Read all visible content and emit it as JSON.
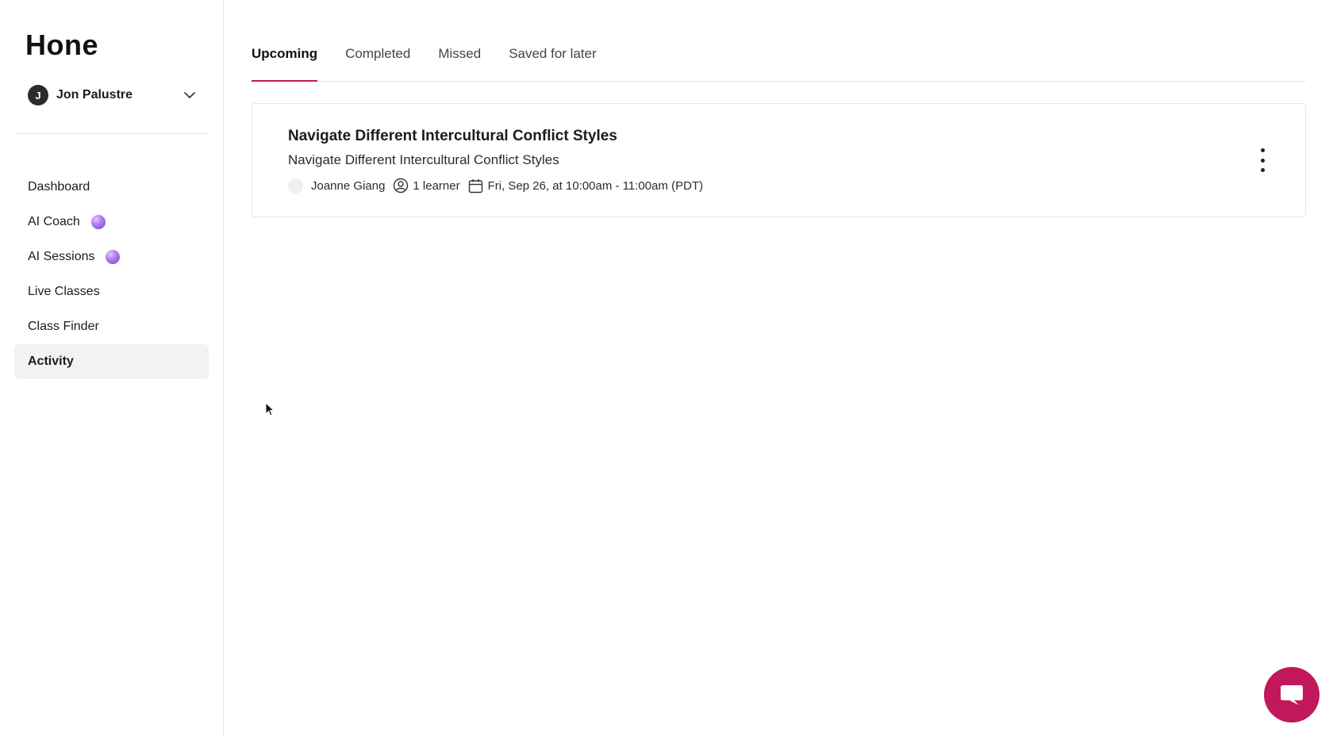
{
  "app": {
    "logo": "Hone"
  },
  "user": {
    "initial": "J",
    "name": "Jon Palustre"
  },
  "nav": {
    "items": [
      {
        "label": "Dashboard",
        "badge": false,
        "active": false
      },
      {
        "label": "AI Coach",
        "badge": true,
        "active": false
      },
      {
        "label": "AI Sessions",
        "badge": true,
        "active": false
      },
      {
        "label": "Live Classes",
        "badge": false,
        "active": false
      },
      {
        "label": "Class Finder",
        "badge": false,
        "active": false
      },
      {
        "label": "Activity",
        "badge": false,
        "active": true
      }
    ]
  },
  "tabs": [
    {
      "label": "Upcoming",
      "active": true
    },
    {
      "label": "Completed",
      "active": false
    },
    {
      "label": "Missed",
      "active": false
    },
    {
      "label": "Saved for later",
      "active": false
    }
  ],
  "session": {
    "title": "Navigate Different Intercultural Conflict Styles",
    "subtitle": "Navigate Different Intercultural Conflict Styles",
    "host": "Joanne Giang",
    "learners": "1 learner",
    "schedule": "Fri, Sep 26, at 10:00am - 11:00am (PDT)"
  },
  "colors": {
    "accent": "#c2185b",
    "orb": "#9b5de5"
  }
}
